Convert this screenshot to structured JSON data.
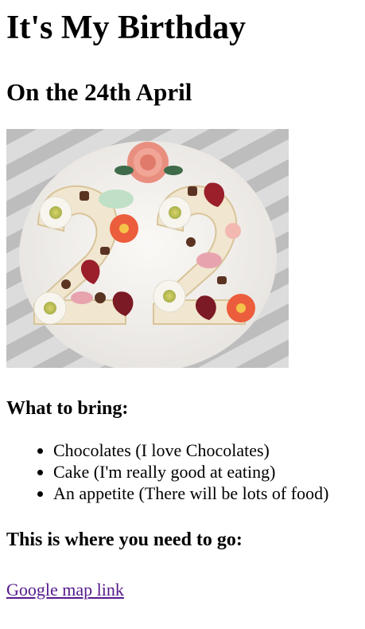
{
  "page": {
    "title": "It's My Birthday",
    "date_heading": "On the 24th April"
  },
  "photo": {
    "number": "22"
  },
  "bring": {
    "heading": "What to bring:",
    "items": [
      "Chocolates (I love Chocolates)",
      "Cake (I'm really good at eating)",
      "An appetite (There will be lots of food)"
    ]
  },
  "location": {
    "heading": "This is where you need to go:",
    "link_text": "Google map link",
    "link_color": "#551a8b"
  }
}
